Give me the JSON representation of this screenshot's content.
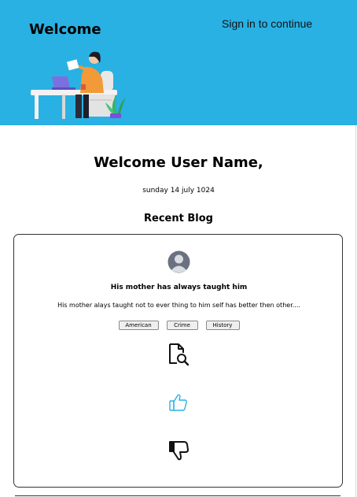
{
  "header": {
    "title": "Welcome",
    "signin_label": "Sign in to continue",
    "background_color": "#29b1e3"
  },
  "main": {
    "greeting": "Welcome User Name,",
    "date": "sunday 14 july 1024",
    "section_title": "Recent Blog"
  },
  "blog_card": {
    "avatar_icon": "user-avatar-icon",
    "title": "His mother has always taught him",
    "excerpt": "His mother alays taught not to ever thing to him self has better then other....",
    "tags": [
      "American",
      "Crime",
      "History"
    ],
    "actions": {
      "view_icon": "document-search-icon",
      "like_icon": "thumbs-up-icon",
      "dislike_icon": "thumbs-down-icon",
      "like_color": "#29b1e3"
    }
  }
}
